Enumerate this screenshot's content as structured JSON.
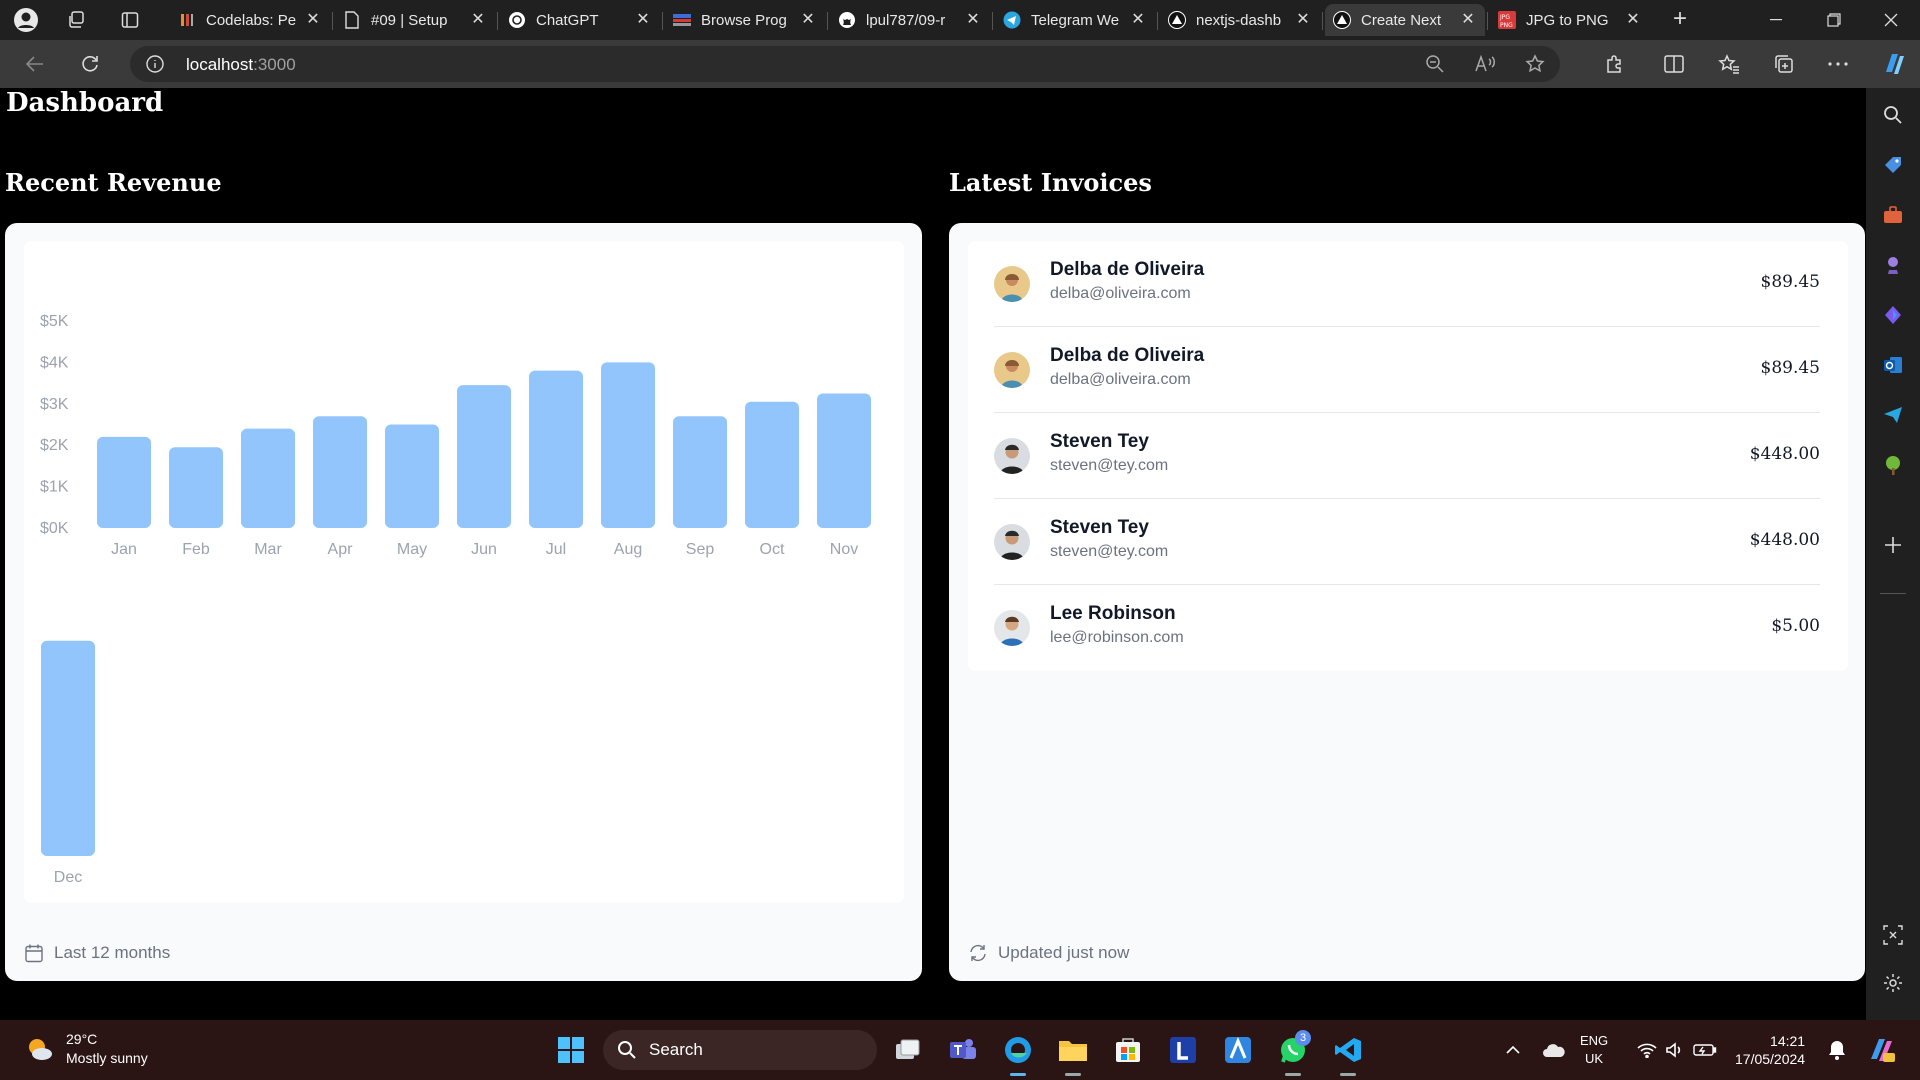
{
  "browser": {
    "tabs": [
      {
        "title": "Codelabs: Pe",
        "icon": "codelabs-icon"
      },
      {
        "title": "#09 | Setup",
        "icon": "document-icon"
      },
      {
        "title": "ChatGPT",
        "icon": "chatgpt-icon"
      },
      {
        "title": "Browse Prog",
        "icon": "browse-icon"
      },
      {
        "title": "lpul787/09-r",
        "icon": "github-icon"
      },
      {
        "title": "Telegram We",
        "icon": "telegram-icon"
      },
      {
        "title": "nextjs-dashb",
        "icon": "vercel-icon"
      },
      {
        "title": "Create Next",
        "icon": "vercel-icon",
        "active": true
      },
      {
        "title": "JPG to PNG",
        "icon": "jpgpng-icon"
      }
    ],
    "close_glyph": "✕",
    "new_tab_glyph": "+",
    "address": {
      "host": "localhost",
      "port": ":3000"
    }
  },
  "page": {
    "title": "Dashboard",
    "revenue_title": "Recent Revenue",
    "invoices_title": "Latest Invoices",
    "chart_footer": "Last 12 months",
    "invoices_footer": "Updated just now"
  },
  "chart_data": {
    "type": "bar",
    "categories": [
      "Jan",
      "Feb",
      "Mar",
      "Apr",
      "May",
      "Jun",
      "Jul",
      "Aug",
      "Sep",
      "Oct",
      "Nov",
      "Dec"
    ],
    "values": [
      2200,
      1950,
      2400,
      2700,
      2500,
      3450,
      3800,
      4000,
      2700,
      3050,
      3250,
      5200
    ],
    "y_ticks": [
      "$5K",
      "$4K",
      "$3K",
      "$2K",
      "$1K",
      "$0K"
    ],
    "ylim": [
      0,
      5000
    ],
    "bar_color": "#93c5fd",
    "label_color": "#9ca3af"
  },
  "invoices": [
    {
      "name": "Delba de Oliveira",
      "email": "delba@oliveira.com",
      "amount": "$89.45",
      "avatar": "avatar-delba"
    },
    {
      "name": "Delba de Oliveira",
      "email": "delba@oliveira.com",
      "amount": "$89.45",
      "avatar": "avatar-delba"
    },
    {
      "name": "Steven Tey",
      "email": "steven@tey.com",
      "amount": "$448.00",
      "avatar": "avatar-steven"
    },
    {
      "name": "Steven Tey",
      "email": "steven@tey.com",
      "amount": "$448.00",
      "avatar": "avatar-steven"
    },
    {
      "name": "Lee Robinson",
      "email": "lee@robinson.com",
      "amount": "$5.00",
      "avatar": "avatar-lee"
    }
  ],
  "taskbar": {
    "weather_temp": "29°C",
    "weather_desc": "Mostly sunny",
    "search_label": "Search",
    "whatsapp_badge": "3",
    "lang_top": "ENG",
    "lang_bottom": "UK",
    "time": "14:21",
    "date": "17/05/2024"
  }
}
